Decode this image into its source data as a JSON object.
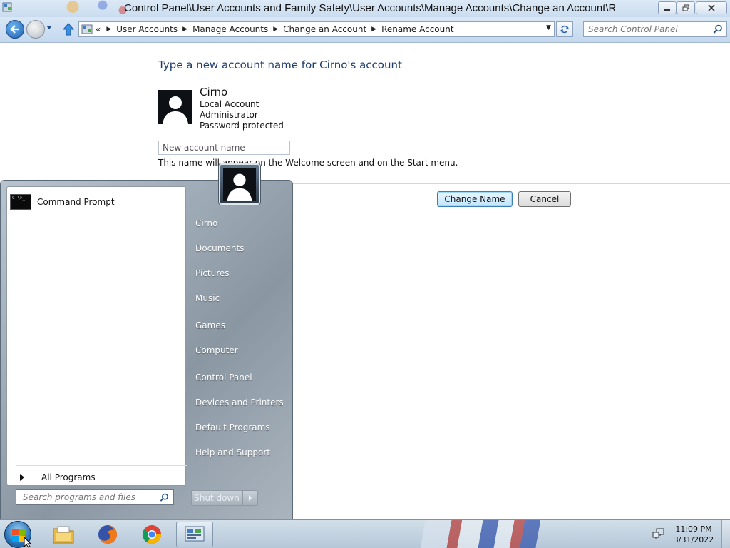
{
  "window": {
    "title": "Control Panel\\User Accounts and Family Safety\\User Accounts\\Manage Accounts\\Change an Account\\R",
    "icon": "control-panel-icon"
  },
  "address_bar": {
    "overflow_marker": "«",
    "breadcrumbs": [
      "User Accounts",
      "Manage Accounts",
      "Change an Account",
      "Rename Account"
    ],
    "search_placeholder": "Search Control Panel"
  },
  "content": {
    "heading": "Type a new account name for Cirno's account",
    "account": {
      "name": "Cirno",
      "details": [
        "Local Account",
        "Administrator",
        "Password protected"
      ]
    },
    "input_placeholder": "New account name",
    "hint": "This name will appear on the Welcome screen and on the Start menu.",
    "buttons": {
      "change_name": "Change Name",
      "cancel": "Cancel"
    }
  },
  "start_menu": {
    "pinned": [
      {
        "label": "Command Prompt",
        "icon": "command-prompt-icon",
        "icon_text": "C:\\>_"
      }
    ],
    "all_programs": "All Programs",
    "search_placeholder": "Search programs and files",
    "right_items": [
      "Cirno",
      "Documents",
      "Pictures",
      "Music",
      "Games",
      "Computer",
      "Control Panel",
      "Devices and Printers",
      "Default Programs",
      "Help and Support"
    ],
    "shutdown_label": "Shut down"
  },
  "taskbar": {
    "apps": [
      "file-explorer-icon",
      "firefox-icon",
      "chrome-icon",
      "control-panel-icon"
    ],
    "clock": {
      "time": "11:09 PM",
      "date": "3/31/2022"
    }
  },
  "colors": {
    "heading": "#1e3d6e",
    "taskbar": "#b5c7d8",
    "start_menu": "#8a97a3",
    "primary_button": "#bee6fd"
  }
}
